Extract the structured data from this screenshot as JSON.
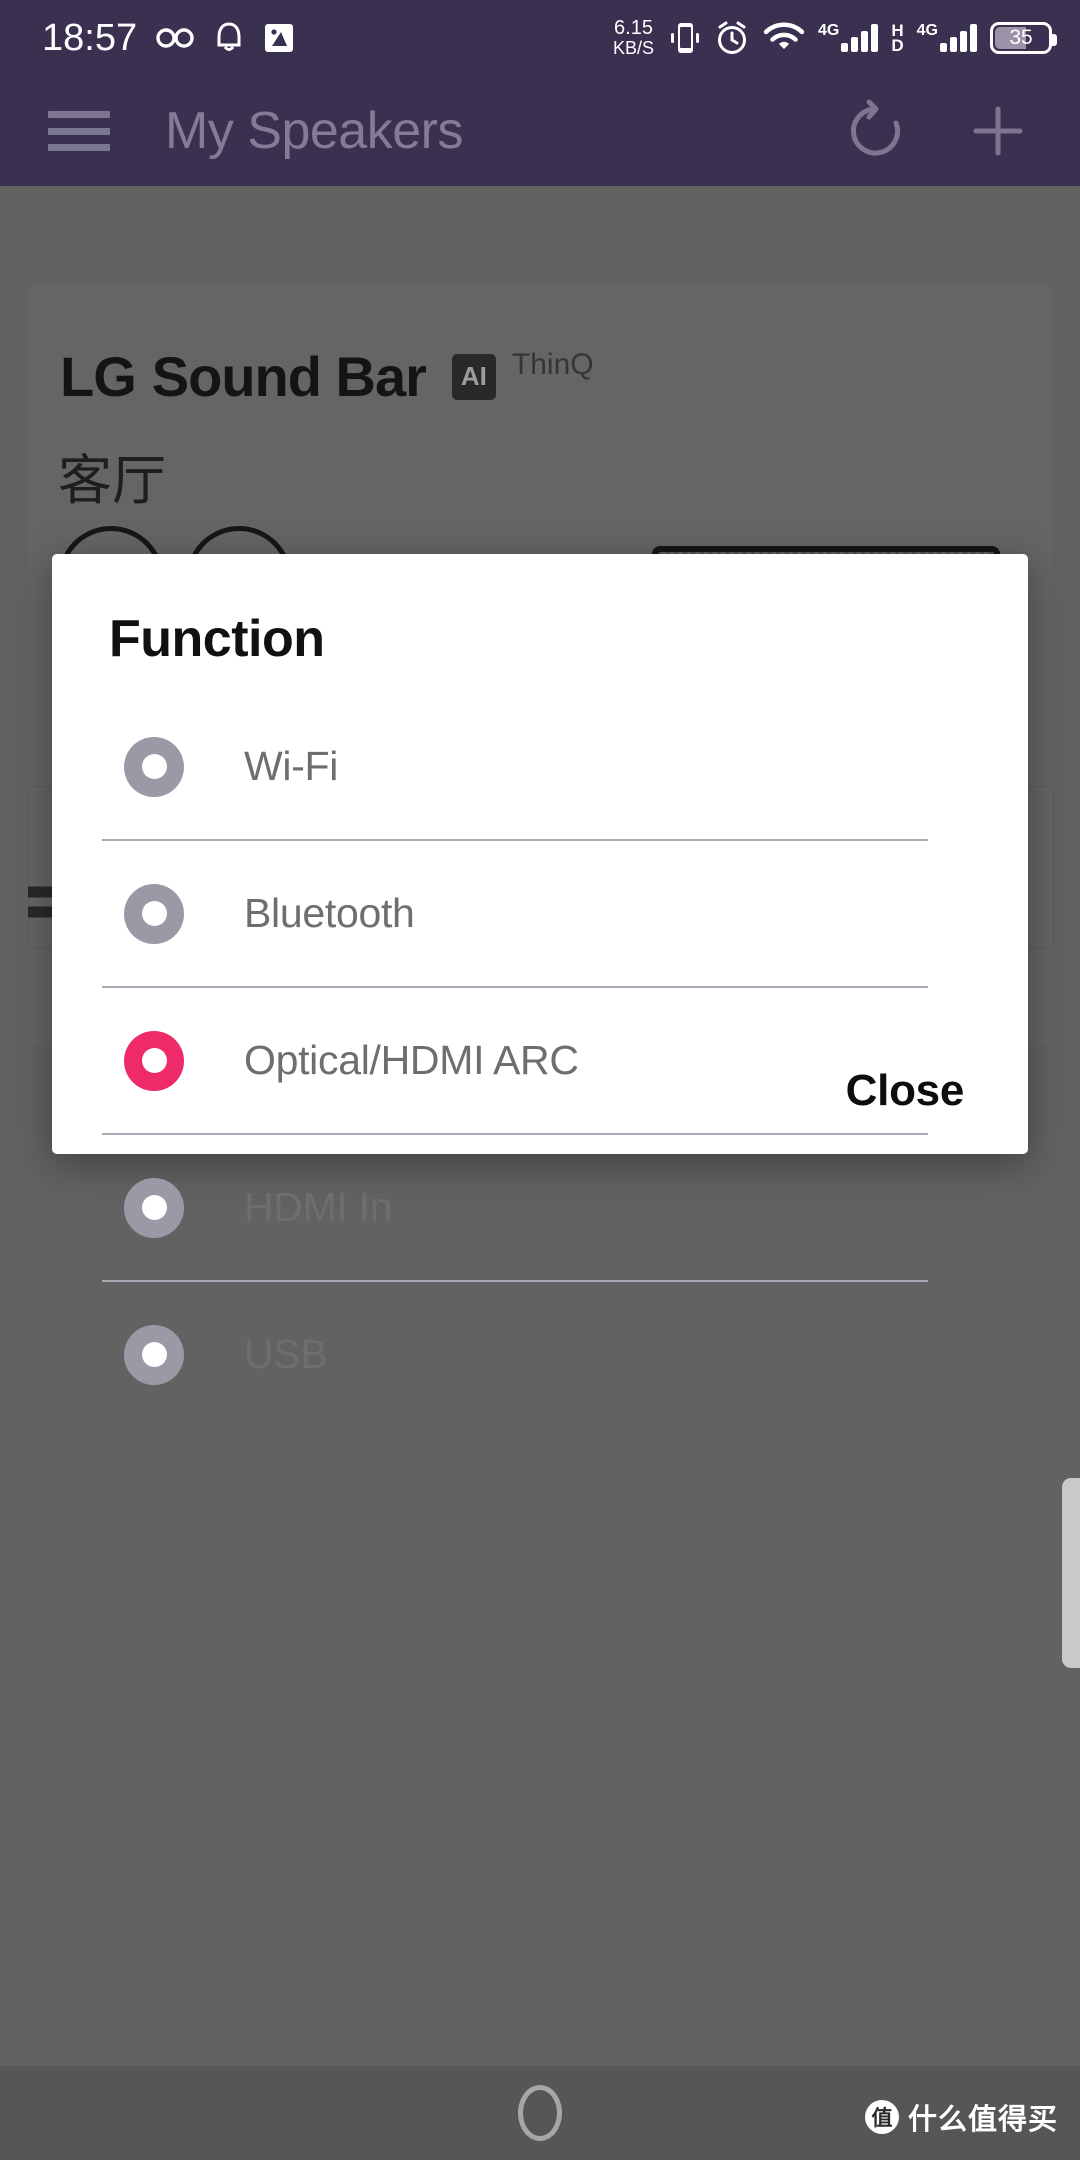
{
  "status_bar": {
    "clock": "18:57",
    "left_icons": [
      "infinity-icon",
      "bell-icon",
      "photo-icon"
    ],
    "network_speed_value": "6.15",
    "network_speed_unit": "KB/S",
    "right_icons": [
      "vibrate-icon",
      "alarm-icon",
      "wifi-icon",
      "signal-4g-icon",
      "hd-icon",
      "signal-4g-icon-2"
    ],
    "sim1_label": "4G",
    "sim2_label": "4G",
    "hd_label_top": "H",
    "hd_label_bottom": "D",
    "battery_percent": "35"
  },
  "app_bar": {
    "menu_icon": "hamburger-menu-icon",
    "title": "My Speakers",
    "refresh_icon": "refresh-icon",
    "add_icon": "plus-icon"
  },
  "device_card": {
    "brand_lg": "LG",
    "brand_product": "Sound Bar",
    "ai_badge": "AI",
    "thinq_label": "ThinQ",
    "room_name": "客厅"
  },
  "dialog": {
    "title": "Function",
    "selected_value": "Optical/HDMI ARC",
    "options": [
      {
        "label": "Wi-Fi",
        "selected": false
      },
      {
        "label": "Bluetooth",
        "selected": false
      },
      {
        "label": "Optical/HDMI ARC",
        "selected": true
      },
      {
        "label": "HDMI In",
        "selected": false
      },
      {
        "label": "USB",
        "selected": false
      }
    ],
    "close_label": "Close"
  },
  "nav_bar": {
    "home_icon": "home-circle-icon"
  },
  "watermark": {
    "logo_char": "值",
    "text": "什么值得买"
  },
  "colors": {
    "status_bar_bg": "#3a3050",
    "app_bar_bg": "#3a3050",
    "accent_pink": "#ee2a68",
    "radio_gray": "#9a9aa6",
    "option_text": "#6d6d72",
    "dialog_bg": "#ffffff",
    "page_bg": "#888888"
  }
}
